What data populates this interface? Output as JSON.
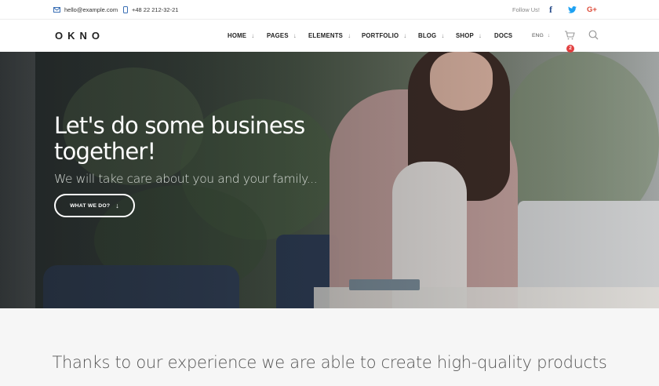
{
  "topbar": {
    "email": "hello@example.com",
    "phone": "+48 22 212-32-21",
    "follow_label": "Follow Us!",
    "social": [
      {
        "icon": "facebook-icon",
        "glyph": "f"
      },
      {
        "icon": "twitter-icon",
        "glyph": "🐦"
      },
      {
        "icon": "google-plus-icon",
        "glyph": "G+"
      }
    ]
  },
  "header": {
    "logo": "OKNO",
    "nav": [
      {
        "label": "HOME",
        "has_dropdown": true
      },
      {
        "label": "PAGES",
        "has_dropdown": true
      },
      {
        "label": "ELEMENTS",
        "has_dropdown": true
      },
      {
        "label": "PORTFOLIO",
        "has_dropdown": true
      },
      {
        "label": "BLOG",
        "has_dropdown": true
      },
      {
        "label": "SHOP",
        "has_dropdown": true
      },
      {
        "label": "DOCS",
        "has_dropdown": false
      }
    ],
    "language": "ENG",
    "cart_count": "2"
  },
  "hero": {
    "title": "Let's do some business together!",
    "subtitle": "We will take care about you and your family...",
    "button_label": "WHAT WE DO?"
  },
  "section": {
    "text": "Thanks to our experience we are able to create high-quality products"
  },
  "colors": {
    "accent": "#e23f3f",
    "facebook": "#2b4e8b",
    "twitter": "#1da1f2",
    "google_plus": "#dd4b39",
    "section_bg": "#f6f6f6"
  }
}
